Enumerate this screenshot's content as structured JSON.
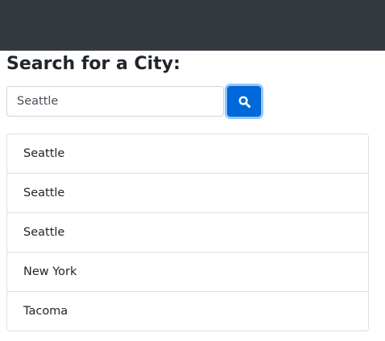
{
  "navbar": {},
  "page": {
    "title": "Search for a City:"
  },
  "search": {
    "value": "Seattle",
    "button_icon": "search-icon"
  },
  "results": [
    {
      "label": "Seattle"
    },
    {
      "label": "Seattle"
    },
    {
      "label": "Seattle"
    },
    {
      "label": "New York"
    },
    {
      "label": "Tacoma"
    }
  ],
  "colors": {
    "navbar_bg": "#343a40",
    "primary": "#0069d9"
  }
}
